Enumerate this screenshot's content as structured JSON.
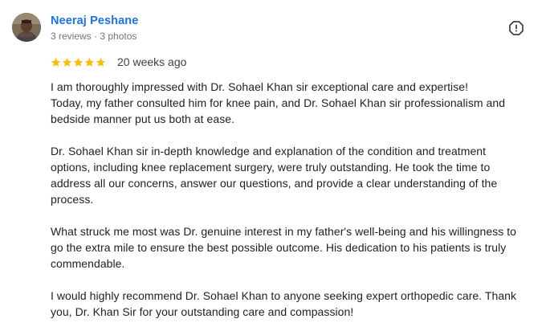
{
  "author": {
    "name": "Neeraj Peshane",
    "meta": "3 reviews · 3 photos"
  },
  "rating": {
    "stars": 5,
    "max": 5,
    "star_color": "#fbbc04",
    "date": "20 weeks ago"
  },
  "icons": {
    "report": "report-flag-icon",
    "star": "star-icon"
  },
  "review": {
    "paragraphs": [
      {
        "lines": [
          "I am thoroughly impressed with Dr. Sohael Khan sir exceptional care and expertise!",
          "Today, my father consulted him for knee pain, and Dr. Sohael Khan sir professionalism and",
          "bedside manner put us both at ease."
        ]
      },
      {
        "lines": [
          "Dr. Sohael Khan sir in-depth knowledge and explanation of the condition and treatment",
          "options, including knee replacement surgery, were truly outstanding. He took the time to",
          "address all our concerns, answer our questions, and provide a clear understanding of the",
          "process."
        ]
      },
      {
        "lines": [
          "What struck me most was Dr. genuine interest in my father's well-being and his willingness to",
          "go the extra mile to ensure the best possible outcome. His dedication to his patients is truly",
          "commendable."
        ]
      },
      {
        "lines": [
          "I would highly recommend Dr. Sohael Khan to anyone seeking expert orthopedic care. Thank",
          "you, Dr. Khan Sir for your outstanding care and compassion!"
        ]
      }
    ]
  }
}
